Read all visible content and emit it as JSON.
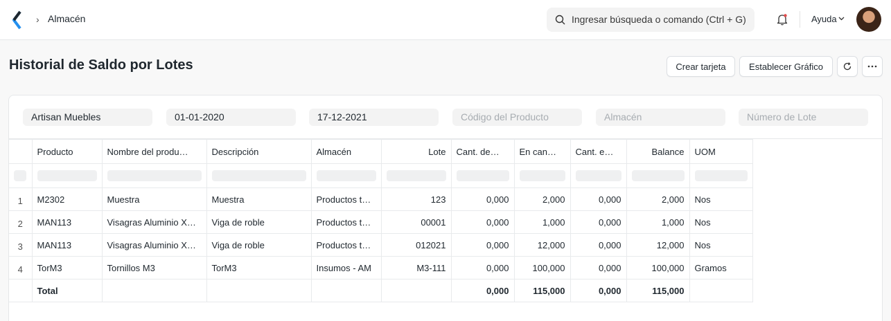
{
  "navbar": {
    "breadcrumb": "Almacén",
    "search_placeholder": "Ingresar búsqueda o comando (Ctrl + G)",
    "help_label": "Ayuda"
  },
  "page": {
    "title": "Historial de Saldo por Lotes",
    "buttons": {
      "crear_tarjeta": "Crear tarjeta",
      "establecer_grafico": "Establecer Gráfico"
    }
  },
  "filters": [
    {
      "value": "Artisan Muebles",
      "placeholder": ""
    },
    {
      "value": "01-01-2020",
      "placeholder": ""
    },
    {
      "value": "17-12-2021",
      "placeholder": ""
    },
    {
      "value": "",
      "placeholder": "Código del Producto"
    },
    {
      "value": "",
      "placeholder": "Almacén"
    },
    {
      "value": "",
      "placeholder": "Número de Lote"
    }
  ],
  "table": {
    "columns": [
      "Producto",
      "Nombre del produ…",
      "Descripción",
      "Almacén",
      "Lote",
      "Cant. de…",
      "En can…",
      "Cant. e…",
      "Balance",
      "UOM"
    ],
    "rows": [
      [
        "1",
        "M2302",
        "Muestra",
        "Muestra",
        "Productos t…",
        "123",
        "0,000",
        "2,000",
        "0,000",
        "2,000",
        "Nos"
      ],
      [
        "2",
        "MAN113",
        "Visagras Aluminio X…",
        "Viga de roble",
        "Productos t…",
        "00001",
        "0,000",
        "1,000",
        "0,000",
        "1,000",
        "Nos"
      ],
      [
        "3",
        "MAN113",
        "Visagras Aluminio X…",
        "Viga de roble",
        "Productos t…",
        "012021",
        "0,000",
        "12,000",
        "0,000",
        "12,000",
        "Nos"
      ],
      [
        "4",
        "TorM3",
        "Tornillos M3",
        "TorM3",
        "Insumos - AM",
        "M3-111",
        "0,000",
        "100,000",
        "0,000",
        "100,000",
        "Gramos"
      ]
    ],
    "total": [
      "",
      "Total",
      "",
      "",
      "",
      "",
      "0,000",
      "115,000",
      "0,000",
      "115,000",
      ""
    ]
  }
}
